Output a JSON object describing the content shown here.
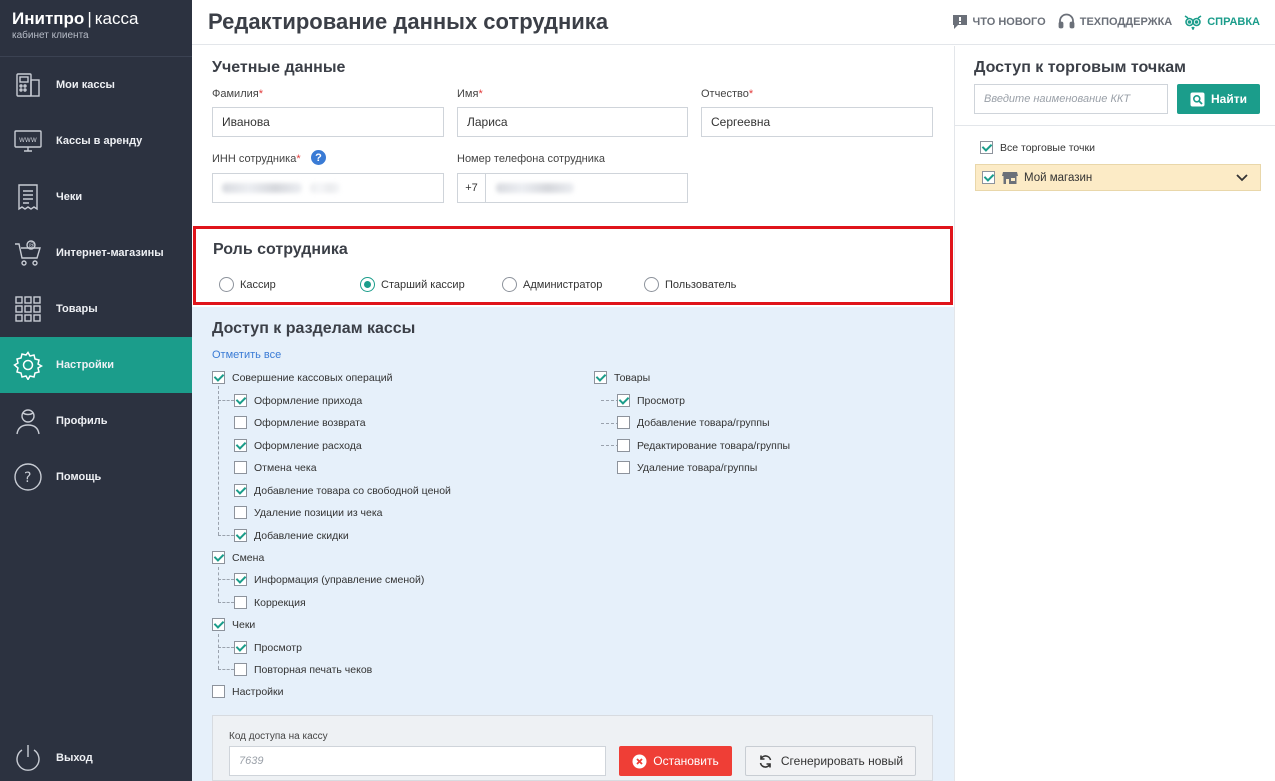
{
  "brand": {
    "name": "Инитпро",
    "separator": "|",
    "product": "касса",
    "subtitle": "кабинет клиента"
  },
  "sidebar": {
    "items": [
      {
        "label": "Мои кассы",
        "icon": "cash-register-icon"
      },
      {
        "label": "Кассы в аренду",
        "icon": "rent-terminal-icon"
      },
      {
        "label": "Чеки",
        "icon": "receipt-icon"
      },
      {
        "label": "Интернет-магазины",
        "icon": "online-cart-icon"
      },
      {
        "label": "Товары",
        "icon": "grid-icon"
      },
      {
        "label": "Настройки",
        "icon": "gear-icon",
        "active": true
      },
      {
        "label": "Профиль",
        "icon": "user-icon"
      },
      {
        "label": "Помощь",
        "icon": "question-icon"
      }
    ],
    "logout": "Выход"
  },
  "header": {
    "title": "Редактирование данных сотрудника",
    "whats_new": "ЧТО НОВОГО",
    "support": "ТЕХПОДДЕРЖКА",
    "help": "СПРАВКА"
  },
  "account": {
    "title": "Учетные данные",
    "lastname_label": "Фамилия",
    "lastname": "Иванова",
    "firstname_label": "Имя",
    "firstname": "Лариса",
    "patronymic_label": "Отчество",
    "patronymic": "Сергеевна",
    "required_mark": "*",
    "inn_label": "ИНН сотрудника",
    "inn_help": "?",
    "phone_label": "Номер телефона сотрудника",
    "phone_prefix": "+7"
  },
  "role": {
    "title": "Роль сотрудника",
    "options": [
      "Кассир",
      "Старший кассир",
      "Администратор",
      "Пользователь"
    ],
    "selected": "Старший кассир"
  },
  "access": {
    "title": "Доступ к разделам кассы",
    "check_all": "Отметить все",
    "groups": [
      {
        "label": "Совершение кассовых операций",
        "checked": true,
        "children": [
          {
            "label": "Оформление прихода",
            "checked": true
          },
          {
            "label": "Оформление возврата",
            "checked": false
          },
          {
            "label": "Оформление расхода",
            "checked": true
          },
          {
            "label": "Отмена чека",
            "checked": false
          },
          {
            "label": "Добавление товара со свободной ценой",
            "checked": true
          },
          {
            "label": "Удаление позиции из чека",
            "checked": false
          },
          {
            "label": "Добавление скидки",
            "checked": true
          }
        ]
      },
      {
        "label": "Смена",
        "checked": true,
        "children": [
          {
            "label": "Информация (управление сменой)",
            "checked": true
          },
          {
            "label": "Коррекция",
            "checked": false
          }
        ]
      },
      {
        "label": "Чеки",
        "checked": true,
        "children": [
          {
            "label": "Просмотр",
            "checked": true
          },
          {
            "label": "Повторная печать чеков",
            "checked": false
          }
        ]
      },
      {
        "label": "Настройки",
        "checked": false,
        "children": []
      }
    ],
    "goods": {
      "label": "Товары",
      "checked": true,
      "children": [
        {
          "label": "Просмотр",
          "checked": true
        },
        {
          "label": "Добавление товара/группы",
          "checked": false
        },
        {
          "label": "Редактирование товара/группы",
          "checked": false
        },
        {
          "label": "Удаление товара/группы",
          "checked": false
        }
      ]
    }
  },
  "access_code": {
    "label": "Код доступа на кассу",
    "placeholder": "7639",
    "stop_button": "Остановить",
    "generate_button": "Сгенерировать новый"
  },
  "stores": {
    "title": "Доступ к торговым точкам",
    "search_placeholder": "Введите наименование ККТ",
    "find_button": "Найти",
    "all_label": "Все торговые точки",
    "all_checked": true,
    "store_name": "Мой магазин",
    "store_checked": true
  },
  "colors": {
    "accent": "#1b9d8b",
    "sidebar_bg": "#2c3240",
    "highlight_border": "#e0141b",
    "danger": "#ef3e36"
  }
}
